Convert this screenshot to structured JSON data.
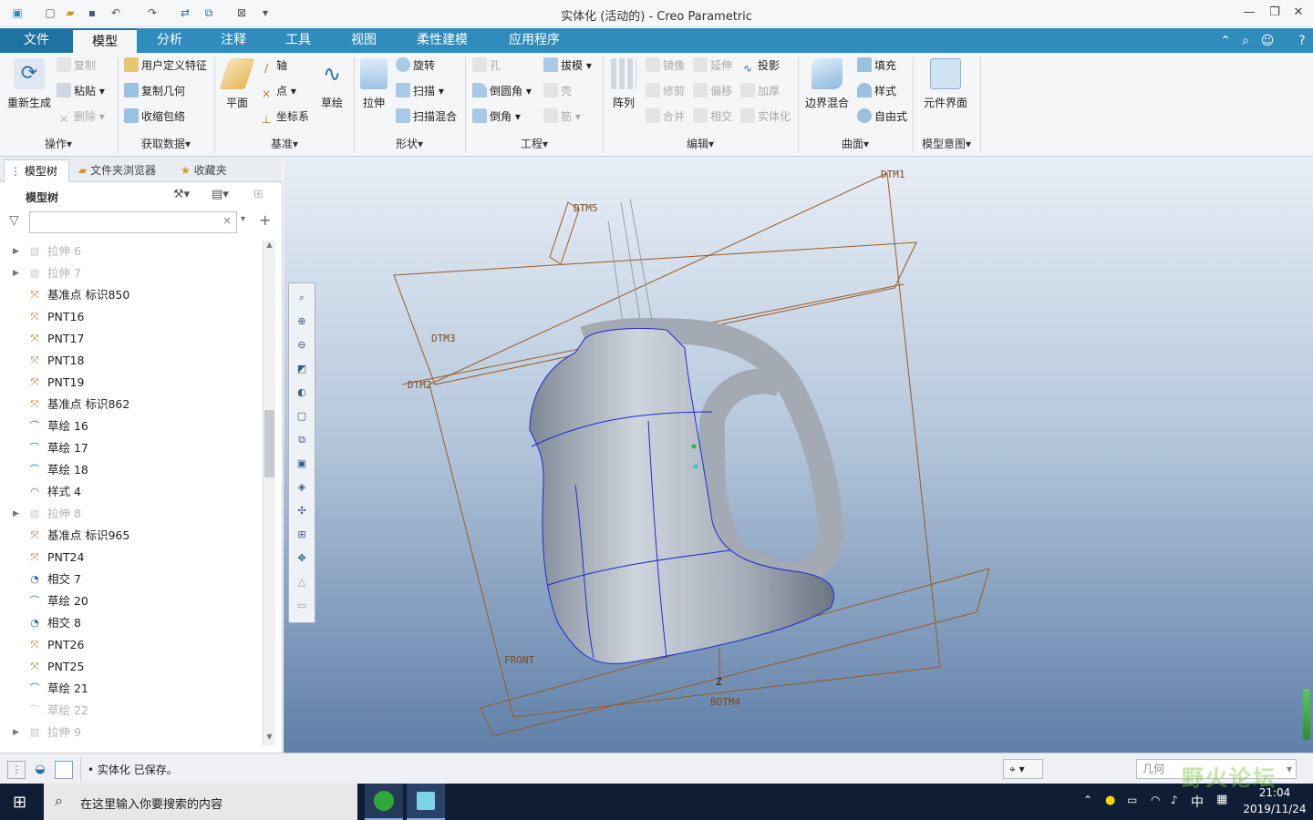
{
  "window": {
    "title": "实体化 (活动的) - Creo Parametric",
    "controls": [
      "minimize-icon",
      "restore-icon",
      "close-icon"
    ]
  },
  "quick_access": [
    "app-icon",
    "new-icon",
    "open-icon",
    "save-icon",
    "undo-icon",
    "redo-icon",
    "regenerate-icon",
    "windows-icon",
    "close-window-icon",
    "customize-icon"
  ],
  "tabs": [
    {
      "label": "文件"
    },
    {
      "label": "模型",
      "active": true
    },
    {
      "label": "分析"
    },
    {
      "label": "注释"
    },
    {
      "label": "工具"
    },
    {
      "label": "视图"
    },
    {
      "label": "柔性建模"
    },
    {
      "label": "应用程序"
    }
  ],
  "ribbon": {
    "groups": [
      "操作▾",
      "获取数据▾",
      "基准▾",
      "形状▾",
      "工程▾",
      "编辑▾",
      "曲面▾",
      "模型意图▾"
    ],
    "operations": {
      "regenerate": "重新生成",
      "copy": "复制",
      "paste": "粘贴",
      "delete": "删除"
    },
    "get_data": {
      "udf": "用户定义特征",
      "copy_geom": "复制几何",
      "shrinkwrap": "收缩包络"
    },
    "datum": {
      "plane": "平面",
      "axis": "轴",
      "point": "点",
      "csys": "坐标系",
      "sketch": "草绘"
    },
    "shapes": {
      "extrude": "拉伸",
      "revolve": "旋转",
      "sweep": "扫描",
      "swept_blend": "扫描混合"
    },
    "engineering": {
      "hole": "孔",
      "draft": "拔模",
      "round": "倒圆角",
      "shell": "壳",
      "chamfer": "倒角",
      "rib": "筋"
    },
    "editing": {
      "pattern": "阵列",
      "mirror": "镜像",
      "extend": "延伸",
      "project": "投影",
      "trim": "修剪",
      "offset": "偏移",
      "thicken": "加厚",
      "merge": "合并",
      "intersect": "相交",
      "solidify": "实体化"
    },
    "surfaces": {
      "boundary_blend": "边界混合",
      "fill": "填充",
      "style": "样式",
      "freestyle": "自由式"
    },
    "model_intent": {
      "component_interface": "元件界面"
    }
  },
  "panel": {
    "tabs": [
      "模型树",
      "文件夹浏览器",
      "收藏夹"
    ],
    "header": "模型树",
    "filter_placeholder": "",
    "tree": [
      {
        "label": "拉伸 6",
        "icon": "extrude-icon",
        "expandable": true,
        "suppressed": true
      },
      {
        "label": "拉伸 7",
        "icon": "extrude-icon",
        "expandable": true,
        "suppressed": true
      },
      {
        "label": "基准点 标识850",
        "icon": "datum-point-icon"
      },
      {
        "label": "PNT16",
        "icon": "datum-point-icon"
      },
      {
        "label": "PNT17",
        "icon": "datum-point-icon"
      },
      {
        "label": "PNT18",
        "icon": "datum-point-icon"
      },
      {
        "label": "PNT19",
        "icon": "datum-point-icon"
      },
      {
        "label": "基准点 标识862",
        "icon": "datum-point-icon"
      },
      {
        "label": "草绘 16",
        "icon": "sketch-icon"
      },
      {
        "label": "草绘 17",
        "icon": "sketch-icon"
      },
      {
        "label": "草绘 18",
        "icon": "sketch-icon"
      },
      {
        "label": "样式 4",
        "icon": "style-icon"
      },
      {
        "label": "拉伸 8",
        "icon": "extrude-icon",
        "expandable": true,
        "suppressed": true
      },
      {
        "label": "基准点 标识965",
        "icon": "datum-point-icon"
      },
      {
        "label": "PNT24",
        "icon": "datum-point-icon"
      },
      {
        "label": "相交 7",
        "icon": "intersect-icon"
      },
      {
        "label": "草绘 20",
        "icon": "sketch-icon"
      },
      {
        "label": "相交 8",
        "icon": "intersect-icon"
      },
      {
        "label": "PNT26",
        "icon": "datum-point-icon"
      },
      {
        "label": "PNT25",
        "icon": "datum-point-icon"
      },
      {
        "label": "草绘 21",
        "icon": "sketch-icon"
      },
      {
        "label": "草绘 22",
        "icon": "sketch-icon",
        "suppressed": true
      },
      {
        "label": "拉伸 9",
        "icon": "extrude-icon",
        "expandable": true,
        "suppressed": true
      }
    ]
  },
  "viewport": {
    "datum_labels": [
      "DTM1",
      "DTM5",
      "DTM3",
      "DTM2",
      "FRONT",
      "Z",
      "BOTM4"
    ]
  },
  "status": {
    "message": "实体化 已保存。",
    "selection_filter": "几何"
  },
  "taskbar": {
    "search_placeholder": "在这里输入你要搜索的内容",
    "time": "21:04",
    "date": "2019/11/24",
    "ime": "中",
    "watermark": "野火论坛"
  }
}
